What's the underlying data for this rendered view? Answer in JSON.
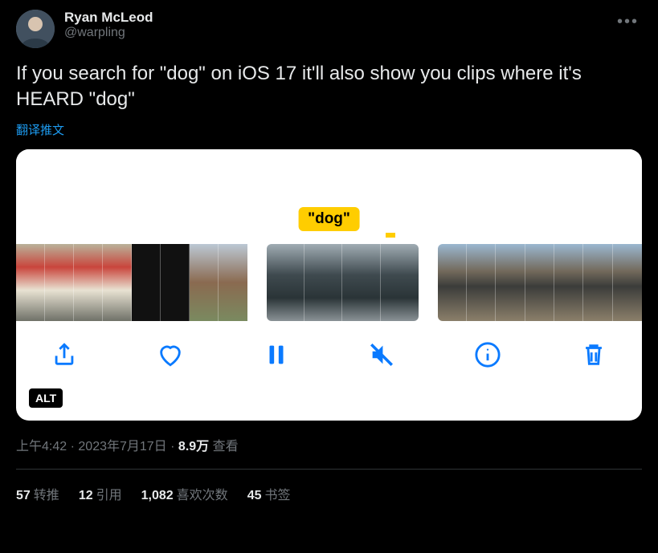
{
  "author": {
    "display_name": "Ryan McLeod",
    "handle": "@warpling"
  },
  "more_label": "•••",
  "body": "If you search for \"dog\" on iOS 17 it'll also show you clips where it's HEARD \"dog\"",
  "translate_label": "翻译推文",
  "media": {
    "search_term": "\"dog\"",
    "alt_badge": "ALT",
    "toolbar": {
      "share": "share-icon",
      "like": "heart-icon",
      "pause": "pause-icon",
      "mute": "mute-icon",
      "info": "info-icon",
      "delete": "trash-icon"
    }
  },
  "meta": {
    "time": "上午4:42",
    "date": "2023年7月17日",
    "views_num": "8.9万",
    "views_label": "查看"
  },
  "stats": {
    "retweets_num": "57",
    "retweets_label": "转推",
    "quotes_num": "12",
    "quotes_label": "引用",
    "likes_num": "1,082",
    "likes_label": "喜欢次数",
    "bookmarks_num": "45",
    "bookmarks_label": "书签"
  }
}
